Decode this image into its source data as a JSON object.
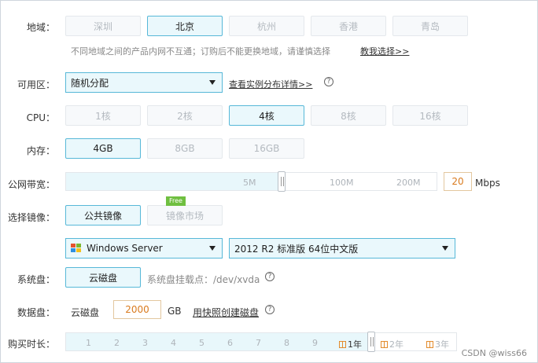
{
  "region": {
    "label": "地域：",
    "options": [
      "深圳",
      "北京",
      "杭州",
      "香港",
      "青岛"
    ],
    "selected": "北京",
    "note": "不同地域之间的产品内网不互通；订购后不能更换地域，请谨慎选择",
    "help_link": "教我选择>>"
  },
  "zone": {
    "label": "可用区：",
    "value": "随机分配",
    "link": "查看实例分布详情>>"
  },
  "cpu": {
    "label": "CPU：",
    "options": [
      "1核",
      "2核",
      "4核",
      "8核",
      "16核"
    ],
    "selected": "4核"
  },
  "memory": {
    "label": "内存：",
    "options": [
      "4GB",
      "8GB",
      "16GB"
    ],
    "selected": "4GB"
  },
  "bandwidth": {
    "label": "公网带宽：",
    "ticks": [
      "5M",
      "100M",
      "200M"
    ],
    "value": "20",
    "unit": "Mbps"
  },
  "image": {
    "label": "选择镜像：",
    "tabs": [
      "公共镜像",
      "镜像市场"
    ],
    "selected": "公共镜像",
    "free_badge": "Free",
    "os": "Windows Server",
    "version": "2012 R2 标准版 64位中文版"
  },
  "system_disk": {
    "label": "系统盘：",
    "type": "云磁盘",
    "note": "系统盘挂载点：/dev/xvda"
  },
  "data_disk": {
    "label": "数据盘：",
    "type": "云磁盘",
    "value": "2000",
    "unit": "GB",
    "link": "用快照创建磁盘"
  },
  "duration": {
    "label": "购买时长：",
    "months": [
      "1",
      "2",
      "3",
      "4",
      "5",
      "6",
      "7",
      "8",
      "9"
    ],
    "years": [
      "1年",
      "2年",
      "3年"
    ],
    "selected": "1年"
  },
  "watermark": "CSDN @wiss66",
  "colors": {
    "accent_border": "#57b8d8",
    "accent_fill": "#eaf8fc",
    "orange": "#d97a1e",
    "free_green": "#6fbf40"
  }
}
